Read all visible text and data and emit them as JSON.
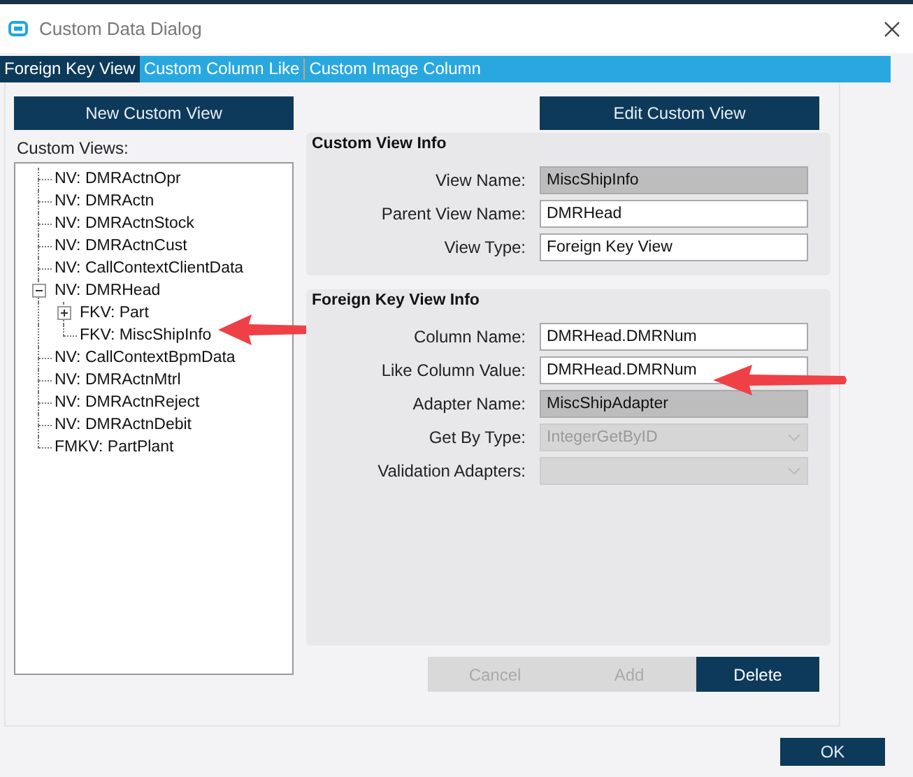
{
  "window": {
    "title": "Custom Data Dialog"
  },
  "tabs": [
    {
      "label": "Foreign Key View",
      "selected": true
    },
    {
      "label": "Custom Column Like",
      "selected": false
    },
    {
      "label": "Custom Image Column",
      "selected": false
    }
  ],
  "left": {
    "new_button": "New Custom View",
    "tree_label": "Custom Views:",
    "tree": [
      {
        "label": "NV: DMRActnOpr"
      },
      {
        "label": "NV: DMRActn"
      },
      {
        "label": "NV: DMRActnStock"
      },
      {
        "label": "NV: DMRActnCust"
      },
      {
        "label": "NV: CallContextClientData"
      },
      {
        "label": "NV: DMRHead",
        "expanded": true,
        "children": [
          {
            "label": "FKV: Part",
            "expanded": false
          },
          {
            "label": "FKV: MiscShipInfo"
          }
        ]
      },
      {
        "label": "NV: CallContextBpmData"
      },
      {
        "label": "NV: DMRActnMtrl"
      },
      {
        "label": "NV: DMRActnReject"
      },
      {
        "label": "NV: DMRActnDebit"
      },
      {
        "label": "FMKV: PartPlant"
      }
    ]
  },
  "edit_button": "Edit Custom View",
  "groups": [
    {
      "title": "Custom View Info",
      "fields": [
        {
          "label": "View Name:",
          "kind": "readonly",
          "value": "MiscShipInfo"
        },
        {
          "label": "Parent View Name:",
          "kind": "text",
          "value": "DMRHead"
        },
        {
          "label": "View Type:",
          "kind": "text",
          "value": "Foreign Key View"
        }
      ]
    },
    {
      "title": "Foreign Key View Info",
      "fields": [
        {
          "label": "Column Name:",
          "kind": "text",
          "value": "DMRHead.DMRNum"
        },
        {
          "label": "Like Column Value:",
          "kind": "text",
          "value": "DMRHead.DMRNum"
        },
        {
          "label": "Adapter Name:",
          "kind": "readonly",
          "value": "MiscShipAdapter"
        },
        {
          "label": "Get By Type:",
          "kind": "select",
          "value": "IntegerGetByID"
        },
        {
          "label": "Validation Adapters:",
          "kind": "select"
        }
      ]
    }
  ],
  "actions": [
    {
      "label": "Cancel",
      "disabled": true
    },
    {
      "label": "Add",
      "disabled": true
    },
    {
      "label": "Delete",
      "disabled": false
    }
  ],
  "ok_button": "OK"
}
